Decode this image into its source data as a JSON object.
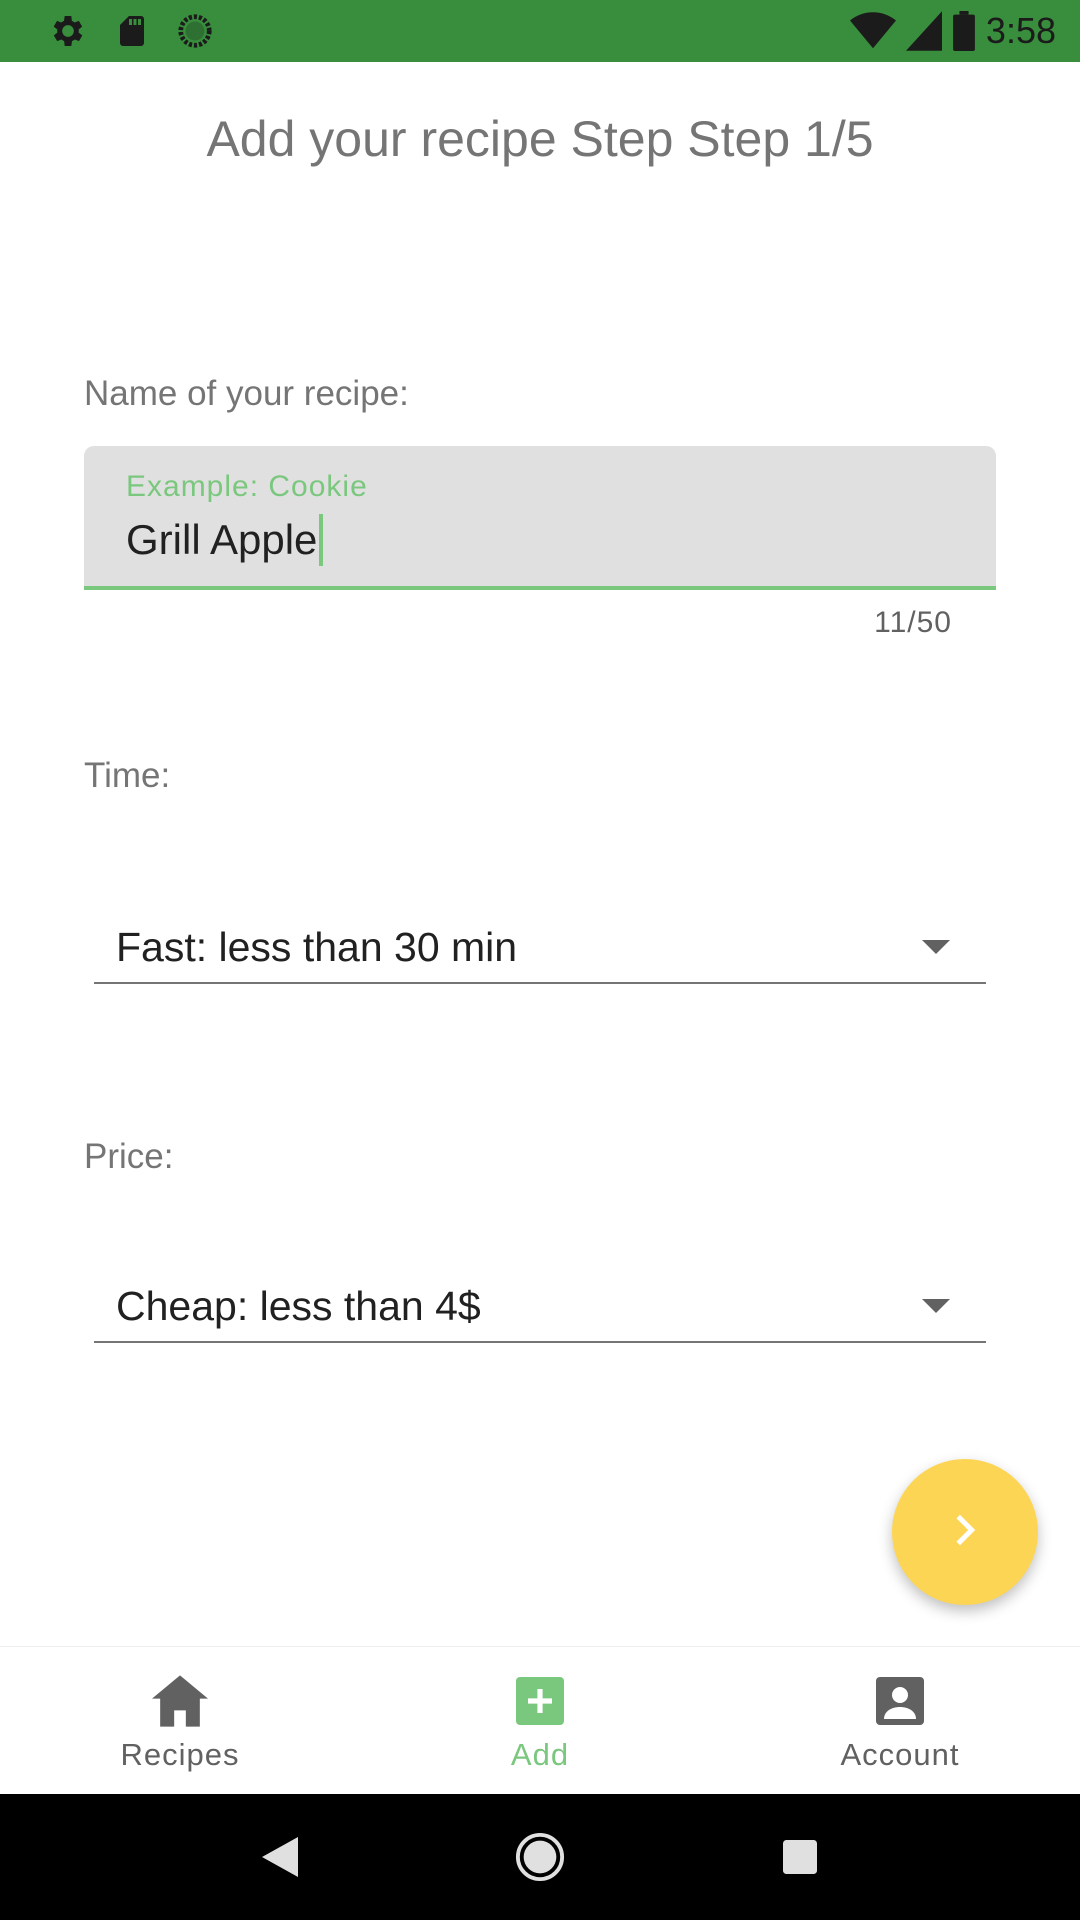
{
  "status_bar": {
    "time": "3:58",
    "icons_left": [
      "settings-icon",
      "sd-card-icon",
      "sync-icon"
    ],
    "icons_right": [
      "wifi-icon",
      "cell-signal-icon",
      "battery-icon"
    ],
    "background": "#388e3c"
  },
  "page": {
    "title": "Add your recipe Step Step 1/5"
  },
  "name_field": {
    "label": "Name of your recipe:",
    "placeholder": "Example: Cookie",
    "value": "Grill Apple",
    "counter": "11/50"
  },
  "time_field": {
    "label": "Time:",
    "selected": "Fast: less than 30 min"
  },
  "price_field": {
    "label": "Price:",
    "selected": "Cheap: less than 4$"
  },
  "fab": {
    "icon": "chevron-right-icon",
    "color": "#fdd555"
  },
  "bottom_nav": {
    "items": [
      {
        "label": "Recipes",
        "icon": "home-icon"
      },
      {
        "label": "Add",
        "icon": "add-box-icon"
      },
      {
        "label": "Account",
        "icon": "account-box-icon"
      }
    ],
    "active_color": "#7ac77e",
    "inactive_color": "#616161"
  },
  "system_nav": {
    "buttons": [
      "back-icon",
      "home-circle-icon",
      "recents-icon"
    ]
  }
}
